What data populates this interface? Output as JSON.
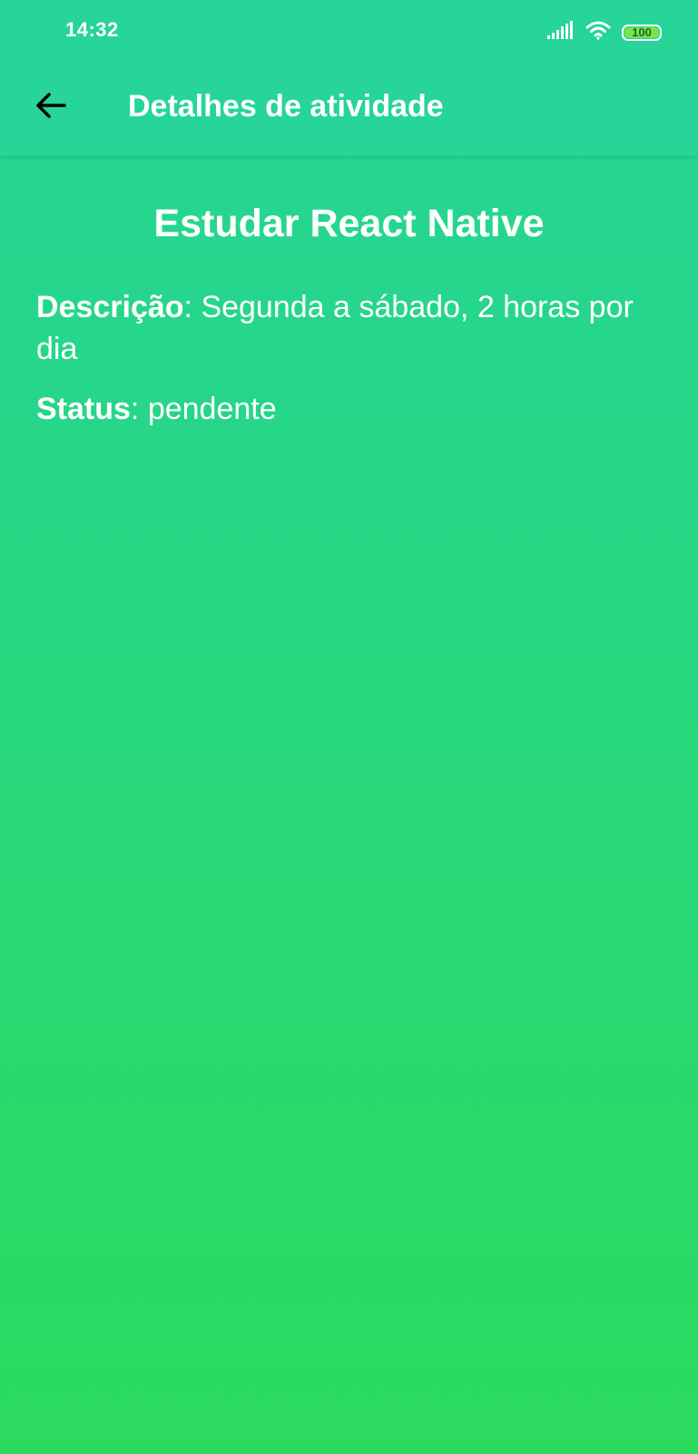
{
  "status_bar": {
    "time": "14:32",
    "battery_level": "100",
    "icons": [
      "signal-icon",
      "wifi-icon",
      "battery-icon"
    ]
  },
  "app_bar": {
    "back_icon": "arrow-left-icon",
    "title": "Detalhes de atividade"
  },
  "activity": {
    "title": "Estudar React Native",
    "description_label": "Descrição",
    "description_value": ": Segunda a sábado, 2 horas por dia",
    "status_label": "Status",
    "status_value": ": pendente"
  },
  "colors": {
    "header": "#26d597",
    "gradient_top": "#26d597",
    "gradient_bottom": "#2bda5d",
    "text": "#ffffff",
    "back_icon": "#000000",
    "battery_fill": "#7be34a"
  }
}
